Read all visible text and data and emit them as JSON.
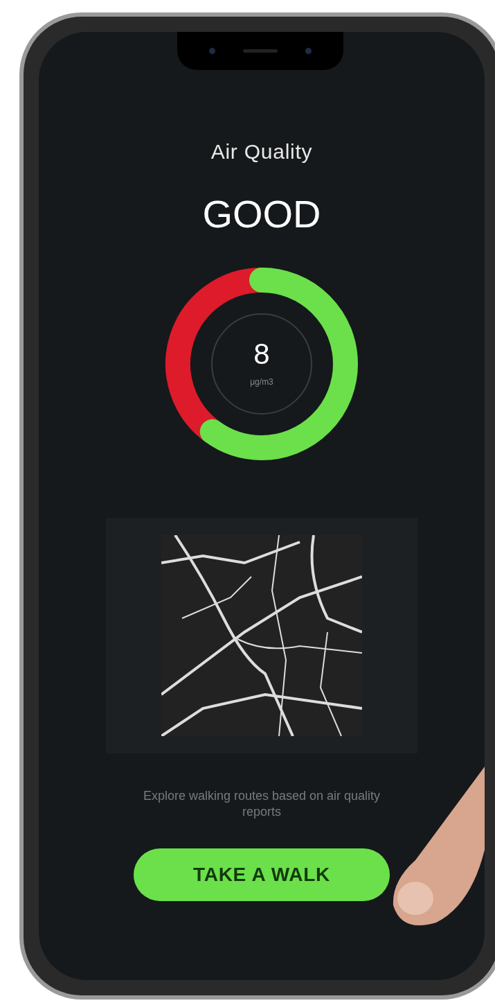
{
  "title": "Air Quality",
  "status": "GOOD",
  "gauge": {
    "level": 0.6,
    "value": "8",
    "unit": "μg/m3"
  },
  "description": "Explore walking routes based on air quality reports",
  "button": {
    "label": "TAKE A WALK"
  }
}
